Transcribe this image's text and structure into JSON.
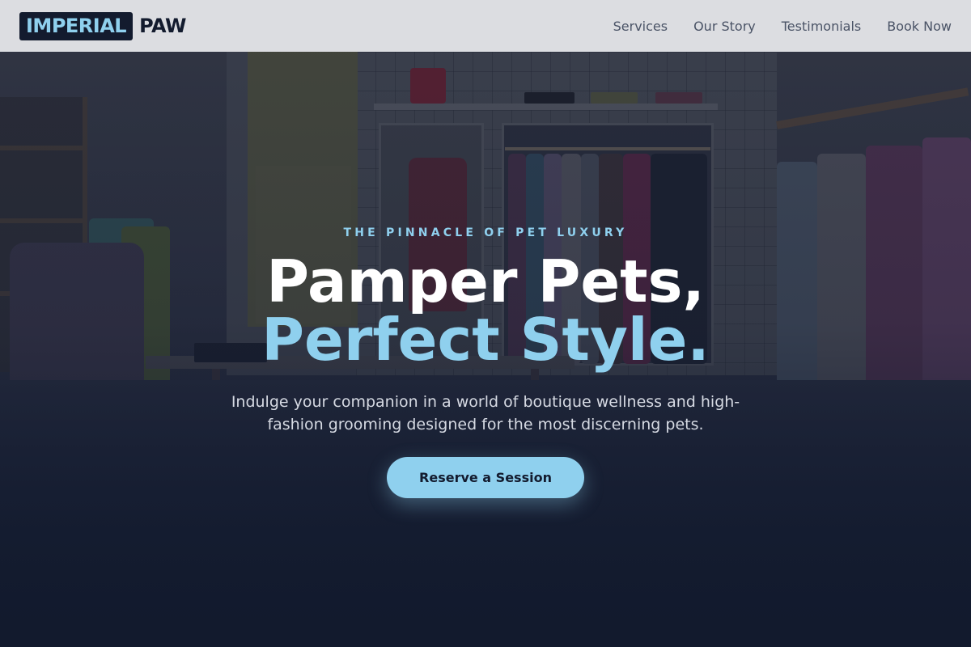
{
  "brand": {
    "name_box": "IMPERIAL",
    "name_text": "PAW",
    "accent_color": "#8fd0ee",
    "dark_color": "#131b2e"
  },
  "nav": {
    "links": [
      {
        "label": "Services"
      },
      {
        "label": "Our Story"
      },
      {
        "label": "Testimonials"
      },
      {
        "label": "Book Now"
      }
    ]
  },
  "hero": {
    "eyebrow": "THE PINNACLE OF PET LUXURY",
    "headline_line1": "Pamper Pets,",
    "headline_line2": "Perfect Style.",
    "subtext": "Indulge your companion in a world of boutique wellness and high-fashion grooming designed for the most discerning pets.",
    "cta_label": "Reserve a Session",
    "background_image": "boutique-interior-photo"
  }
}
